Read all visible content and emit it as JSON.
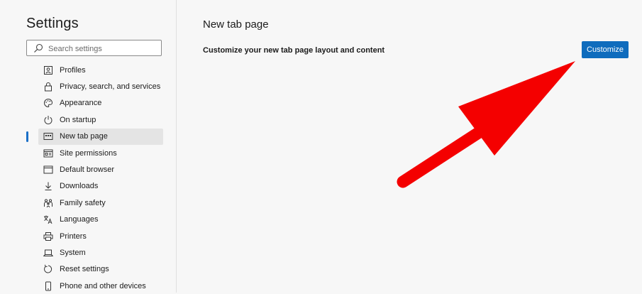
{
  "app": {
    "title": "Settings"
  },
  "search": {
    "placeholder": "Search settings"
  },
  "sidebar": {
    "items": [
      {
        "label": "Profiles",
        "icon": "profile-icon",
        "active": false
      },
      {
        "label": "Privacy, search, and services",
        "icon": "lock-icon",
        "active": false
      },
      {
        "label": "Appearance",
        "icon": "palette-icon",
        "active": false
      },
      {
        "label": "On startup",
        "icon": "power-icon",
        "active": false
      },
      {
        "label": "New tab page",
        "icon": "new-tab-icon",
        "active": true
      },
      {
        "label": "Site permissions",
        "icon": "site-permissions-icon",
        "active": false
      },
      {
        "label": "Default browser",
        "icon": "browser-icon",
        "active": false
      },
      {
        "label": "Downloads",
        "icon": "download-icon",
        "active": false
      },
      {
        "label": "Family safety",
        "icon": "family-icon",
        "active": false
      },
      {
        "label": "Languages",
        "icon": "languages-icon",
        "active": false
      },
      {
        "label": "Printers",
        "icon": "printer-icon",
        "active": false
      },
      {
        "label": "System",
        "icon": "laptop-icon",
        "active": false
      },
      {
        "label": "Reset settings",
        "icon": "reset-icon",
        "active": false
      },
      {
        "label": "Phone and other devices",
        "icon": "phone-icon",
        "active": false
      }
    ]
  },
  "main": {
    "title": "New tab page",
    "row_label": "Customize your new tab page layout and content",
    "customize_label": "Customize"
  },
  "colors": {
    "accent": "#0f6cbd",
    "annotation_arrow": "#f40000",
    "active_indicator": "#1a6fc7"
  }
}
